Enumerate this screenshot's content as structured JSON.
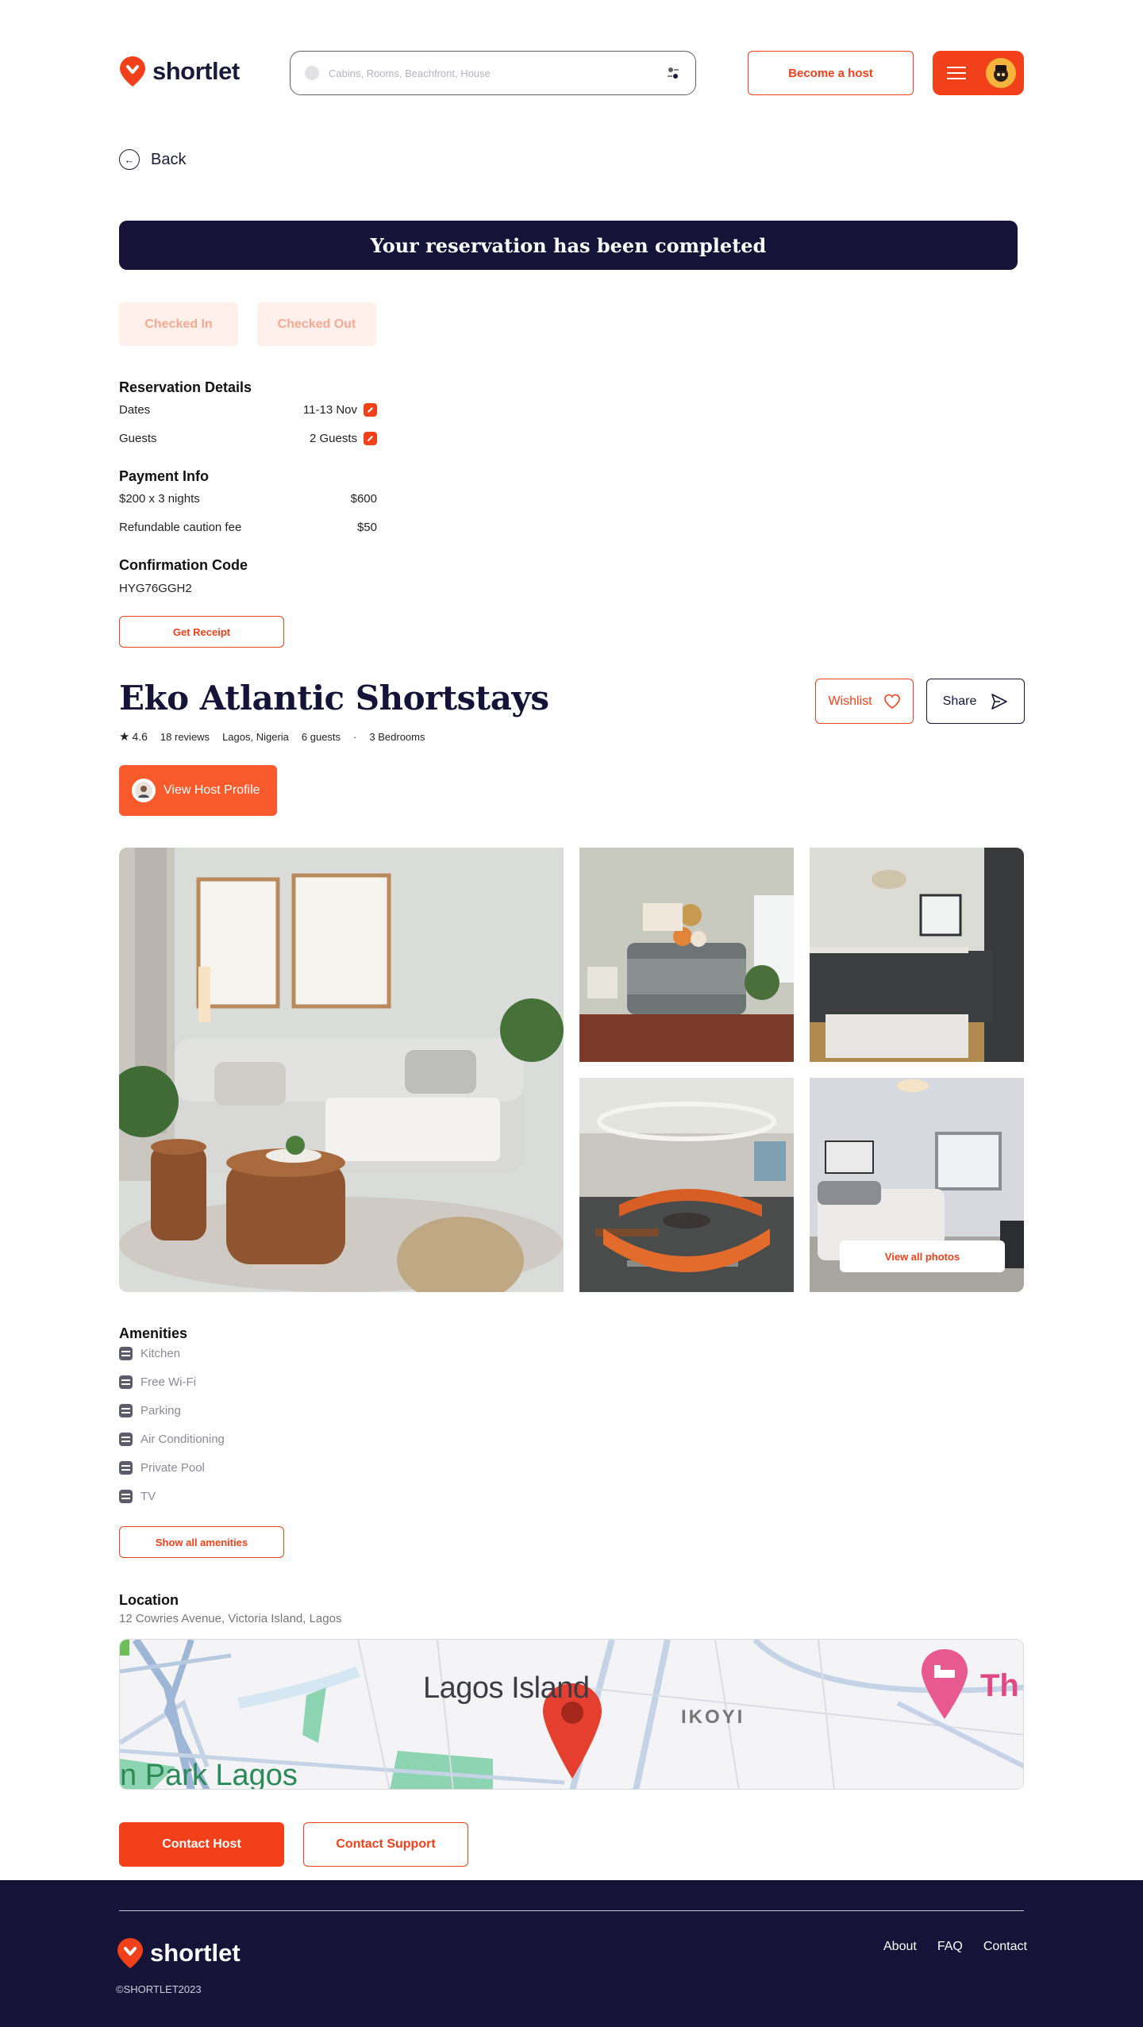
{
  "header": {
    "logo_text": "shortlet",
    "search_placeholder": "Cabins, Rooms, Beachfront, House",
    "become_host": "Become a host"
  },
  "back_label": "Back",
  "banner": "Your reservation has been completed",
  "status_chips": [
    "Checked In",
    "Checked Out"
  ],
  "reservation": {
    "title": "Reservation Details",
    "dates_label": "Dates",
    "dates_value": "11-13 Nov",
    "guests_label": "Guests",
    "guests_value": "2 Guests"
  },
  "payment": {
    "title": "Payment Info",
    "line1_label": "$200 x 3 nights",
    "line1_value": "$600",
    "line2_label": "Refundable caution fee",
    "line2_value": "$50"
  },
  "confirmation": {
    "title": "Confirmation Code",
    "code": "HYG76GGH2",
    "receipt_button": "Get Receipt"
  },
  "listing": {
    "title": "Eko Atlantic Shortstays",
    "rating": "4.6",
    "reviews": "18 reviews",
    "location": "Lagos, Nigeria",
    "guests": "6 guests",
    "separator": "·",
    "bedrooms": "3 Bedrooms",
    "wishlist": "Wishlist",
    "share": "Share",
    "host_profile": "View Host Profile",
    "view_all_photos": "View all photos"
  },
  "amenities": {
    "title": "Amenities",
    "items": [
      "Kitchen",
      "Free Wi-Fi",
      "Parking",
      "Air Conditioning",
      "Private Pool",
      "TV"
    ],
    "show_all": "Show all amenities"
  },
  "location": {
    "title": "Location",
    "address": "12 Cowries Avenue, Victoria Island, Lagos",
    "map_labels": [
      "Lagos Island",
      "IKOYI",
      "n Park Lagos",
      "Th"
    ]
  },
  "actions": {
    "contact_host": "Contact Host",
    "contact_support": "Contact Support"
  },
  "footer": {
    "logo_text": "shortlet",
    "copyright": "©SHORTLET2023",
    "links": [
      "About",
      "FAQ",
      "Contact"
    ]
  },
  "colors": {
    "accent": "#f2411a",
    "navy": "#161339",
    "chip_bg": "#fff0eb"
  }
}
